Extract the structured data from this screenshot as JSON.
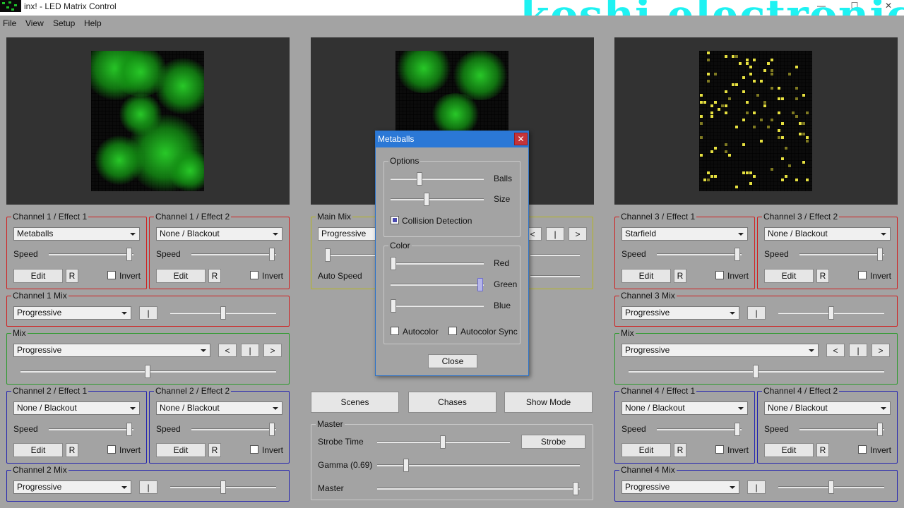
{
  "window": {
    "title": "inx! - LED Matrix Control",
    "min": "—",
    "max": "☐",
    "close": "✕"
  },
  "watermark": "koshi electronics",
  "menu": [
    "File",
    "View",
    "Setup",
    "Help"
  ],
  "ch1e1": {
    "title": "Channel 1 / Effect 1",
    "effect": "Metaballs",
    "speed_label": "Speed",
    "speed": 0.95,
    "edit": "Edit",
    "reset": "R",
    "invert": "Invert"
  },
  "ch1e2": {
    "title": "Channel 1 / Effect 2",
    "effect": "None / Blackout",
    "speed_label": "Speed",
    "speed": 0.95,
    "edit": "Edit",
    "reset": "R",
    "invert": "Invert"
  },
  "ch1mix": {
    "title": "Channel 1 Mix",
    "mode": "Progressive",
    "btn": "|",
    "level": 0.5
  },
  "mix1": {
    "title": "Mix",
    "mode": "Progressive",
    "prev": "<",
    "mid": "|",
    "next": ">",
    "level": 0.5
  },
  "ch2e1": {
    "title": "Channel 2 / Effect 1",
    "effect": "None / Blackout",
    "speed_label": "Speed",
    "speed": 0.95,
    "edit": "Edit",
    "reset": "R",
    "invert": "Invert"
  },
  "ch2e2": {
    "title": "Channel 2 / Effect 2",
    "effect": "None / Blackout",
    "speed_label": "Speed",
    "speed": 0.95,
    "edit": "Edit",
    "reset": "R",
    "invert": "Invert"
  },
  "ch2mix": {
    "title": "Channel 2 Mix",
    "mode": "Progressive",
    "btn": "|",
    "level": 0.5
  },
  "mainmix": {
    "title": "Main Mix",
    "mode": "Progressive",
    "auto_speed": "Auto Speed",
    "prev": "<",
    "mid": "|",
    "next": ">"
  },
  "ch3e1": {
    "title": "Channel 3 / Effect 1",
    "effect": "Starfield",
    "speed_label": "Speed",
    "speed": 0.95,
    "edit": "Edit",
    "reset": "R",
    "invert": "Invert"
  },
  "ch3e2": {
    "title": "Channel 3 / Effect 2",
    "effect": "None / Blackout",
    "speed_label": "Speed",
    "speed": 0.95,
    "edit": "Edit",
    "reset": "R",
    "invert": "Invert"
  },
  "ch3mix": {
    "title": "Channel 3 Mix",
    "mode": "Progressive",
    "btn": "|",
    "level": 0.5
  },
  "mix2": {
    "title": "Mix",
    "mode": "Progressive",
    "prev": "<",
    "mid": "|",
    "next": ">",
    "level": 0.5
  },
  "ch4e1": {
    "title": "Channel 4 / Effect 1",
    "effect": "None / Blackout",
    "speed_label": "Speed",
    "speed": 0.95,
    "edit": "Edit",
    "reset": "R",
    "invert": "Invert"
  },
  "ch4e2": {
    "title": "Channel 4 / Effect 2",
    "effect": "None / Blackout",
    "speed_label": "Speed",
    "speed": 0.95,
    "edit": "Edit",
    "reset": "R",
    "invert": "Invert"
  },
  "ch4mix": {
    "title": "Channel 4 Mix",
    "mode": "Progressive",
    "btn": "|",
    "level": 0.5
  },
  "center_buttons": {
    "scenes": "Scenes",
    "chases": "Chases",
    "show_mode": "Show Mode"
  },
  "master": {
    "title": "Master",
    "strobe_time": "Strobe Time",
    "strobe_value": 0.5,
    "strobe_btn": "Strobe",
    "gamma": "Gamma (0.69)",
    "gamma_value": 0.15,
    "master": "Master",
    "master_value": 1.0
  },
  "dialog": {
    "title": "Metaballs",
    "close_x": "✕",
    "options": {
      "title": "Options",
      "balls": "Balls",
      "balls_value": 0.3,
      "size": "Size",
      "size_value": 0.38,
      "collision": "Collision Detection",
      "collision_checked": true
    },
    "color": {
      "title": "Color",
      "red": "Red",
      "red_value": 0.0,
      "green": "Green",
      "green_value": 1.0,
      "blue": "Blue",
      "blue_value": 0.0,
      "autocolor": "Autocolor",
      "autocolor_sync": "Autocolor Sync"
    },
    "close_btn": "Close"
  }
}
